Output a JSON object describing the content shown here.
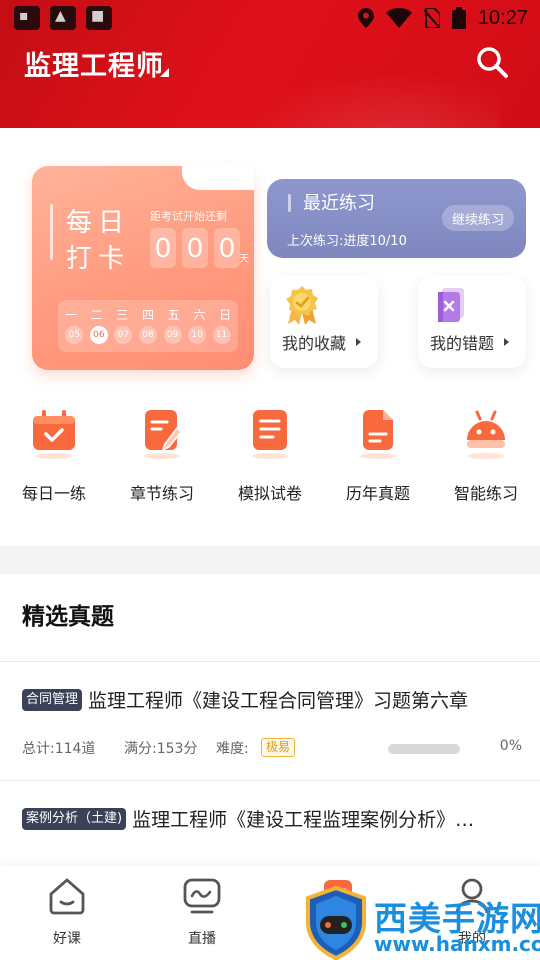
{
  "status_bar": {
    "time": "10:27"
  },
  "header": {
    "title": "监理工程师"
  },
  "checkin": {
    "line1": "每日",
    "line2": "打卡",
    "countdown_label": "距考试开始还剩",
    "digits": [
      "0",
      "0",
      "0"
    ],
    "day_unit": "天",
    "weekdays": [
      "一",
      "二",
      "三",
      "四",
      "五",
      "六",
      "日"
    ],
    "dates": [
      "05",
      "06",
      "07",
      "08",
      "09",
      "10",
      "11"
    ],
    "active_date": "06"
  },
  "recent": {
    "title": "最近练习",
    "subtitle": "上次练习:进度10/10",
    "button": "继续练习"
  },
  "favorites": {
    "label": "我的收藏"
  },
  "mistakes": {
    "label": "我的错题"
  },
  "quick_nav": [
    {
      "label": "每日一练",
      "icon": "calendar-check-icon"
    },
    {
      "label": "章节练习",
      "icon": "edit-note-icon"
    },
    {
      "label": "模拟试卷",
      "icon": "exam-paper-icon"
    },
    {
      "label": "历年真题",
      "icon": "document-icon"
    },
    {
      "label": "智能练习",
      "icon": "robot-icon"
    }
  ],
  "featured": {
    "title": "精选真题",
    "items": [
      {
        "tag": "合同管理",
        "title": "监理工程师《建设工程合同管理》习题第六章",
        "total": "总计:114道",
        "score": "满分:153分",
        "difficulty_label": "难度:",
        "difficulty": "极易",
        "progress": 0,
        "progress_text": "0%"
      },
      {
        "tag": "案例分析（土建)",
        "title": "监理工程师《建设工程监理案例分析》…"
      }
    ]
  },
  "bottom_nav": [
    {
      "label": "好课",
      "icon": "home-icon"
    },
    {
      "label": "直播",
      "icon": "live-tv-icon"
    },
    {
      "label": "",
      "icon": "question-bank-icon"
    },
    {
      "label": "我的",
      "icon": "profile-icon"
    }
  ],
  "watermark": {
    "name": "西美手游网",
    "url": "www.hanxm.com"
  },
  "colors": {
    "header_red": "#d10c16",
    "checkin_orange": "#ff9a7f",
    "recent_purple": "#8e97cf",
    "icon_orange": "#f86a3d",
    "tag_dark": "#3b4156",
    "difficulty_yellow": "#f2b33a"
  }
}
